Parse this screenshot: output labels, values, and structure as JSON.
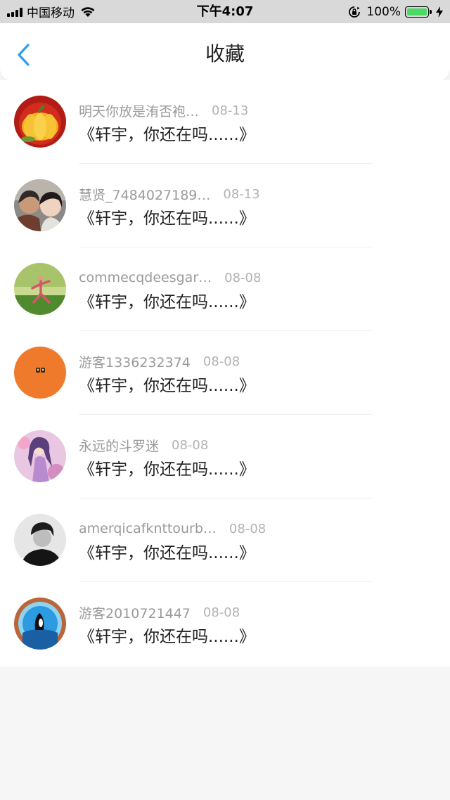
{
  "status_bar": {
    "carrier": "中国移动",
    "time": "下午4:07",
    "battery": "100%"
  },
  "nav": {
    "title": "收藏"
  },
  "favorites": [
    {
      "name": "明天你放是洧否袍…",
      "date": "08-13",
      "message": "《轩宇，你还在吗......》"
    },
    {
      "name": "慧贤_7484027189…",
      "date": "08-13",
      "message": "《轩宇，你还在吗......》"
    },
    {
      "name": "commecqdeesgar…",
      "date": "08-08",
      "message": "《轩宇，你还在吗......》"
    },
    {
      "name": "游客1336232374",
      "date": "08-08",
      "message": "《轩宇，你还在吗......》"
    },
    {
      "name": "永远的斗罗迷",
      "date": "08-08",
      "message": "《轩宇，你还在吗......》"
    },
    {
      "name": "amerqicafknttourb…",
      "date": "08-08",
      "message": "《轩宇，你还在吗......》"
    },
    {
      "name": "游客2010721447",
      "date": "08-08",
      "message": "《轩宇，你还在吗......》"
    }
  ],
  "colors": {
    "accent_blue": "#2b9df0",
    "battery_green": "#4cd964",
    "name_gray": "#9a9a9a",
    "date_gray": "#b2b2b2"
  },
  "icons": [
    "signal-icon",
    "wifi-icon",
    "orientation-lock-icon",
    "battery-icon",
    "charging-icon",
    "back-chevron-icon"
  ]
}
